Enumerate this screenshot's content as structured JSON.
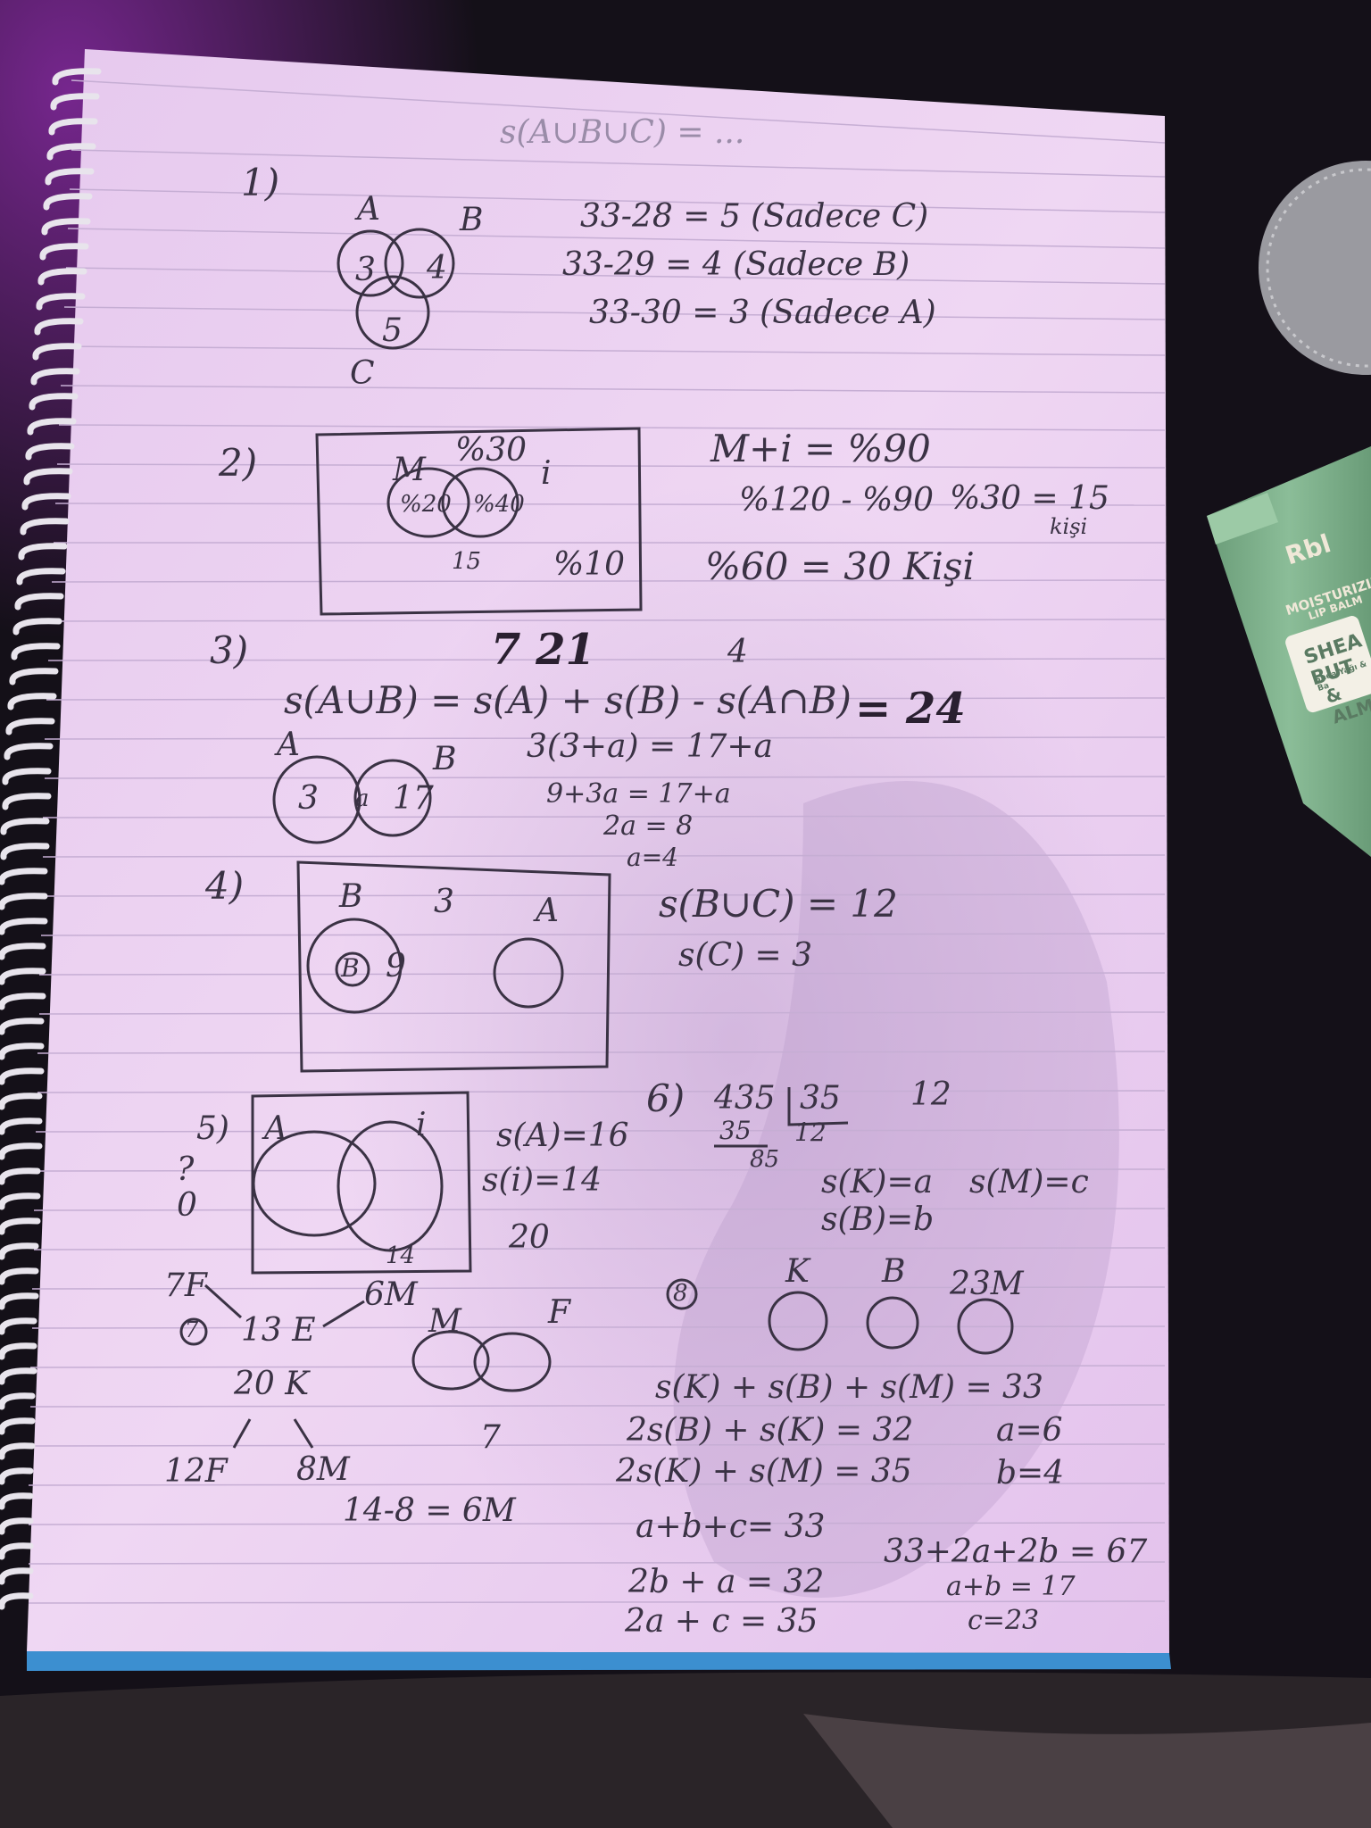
{
  "notebook": {
    "paper_color": "#e9cff0",
    "line_color": "#c9b4d4",
    "ink_color": "#3a3244",
    "binding": "spiral"
  },
  "tube": {
    "brand": "Rbl",
    "line1": "MOISTURIZIN",
    "line2": "LIP BALM",
    "name1": "SHEA BUT",
    "sub": "Shea Yağı & Ba",
    "name2": "& ALM",
    "color": "#7fae8c"
  },
  "problems": {
    "p1": {
      "num": "1)",
      "setA": "A",
      "setB": "B",
      "setC": "C",
      "r3": "3",
      "r4": "4",
      "r5": "5",
      "eq1": "33-28 = 5 (Sadece C)",
      "eq2": "33-29 = 4 (Sadece B)",
      "eq3": "33-30 = 3 (Sadece A)"
    },
    "p2": {
      "num": "2)",
      "m": "M",
      "i": "i",
      "top": "%30",
      "left": "%20",
      "mid": "%40",
      "out": "%10",
      "bottom": "15",
      "eq1": "M+i = %90",
      "eq2": "%120 - %90",
      "eq3": "%30 = 15",
      "eq3b": "kişi",
      "eq4": "%60 = 30 Kişi"
    },
    "p3": {
      "num": "3)",
      "above": "7   21",
      "above2": "4",
      "formula": "s(A∪B) = s(A) + s(B) - s(A∩B)",
      "result": "= 24",
      "a": "A",
      "b": "B",
      "r1": "3",
      "r2": "a",
      "r3": "17",
      "eq1": "3(3+a) = 17+a",
      "eq2": "9+3a = 17+a",
      "eq3": "2a = 8",
      "eq4": "a=4"
    },
    "p4": {
      "num": "4)",
      "b": "B",
      "three": "3",
      "a": "A",
      "inner": "B",
      "nine": "9",
      "eq1": "s(B∪C) = 12",
      "eq2": "s(C) = 3"
    },
    "p5": {
      "num": "5)",
      "a": "A",
      "i": "i",
      "q": "?",
      "zero": "0",
      "below": "14",
      "eq1": "s(A)=16",
      "eq2": "s(i)=14",
      "eq3": "20"
    },
    "p6": {
      "num": "6)",
      "div1": "435",
      "div2": "35",
      "q": "12",
      "sub": "35",
      "rem": "85",
      "side": "12",
      "eq1": "s(K)=a",
      "eq2": "s(B)=b",
      "eq3": "s(M)=c"
    },
    "p7": {
      "num": "7",
      "f7": "7F",
      "e": "13 E",
      "m6": "6M",
      "k": "20 K",
      "f12": "12F",
      "m8": "8M",
      "eq": "14-8 = 6M",
      "m": "M",
      "f": "F",
      "seven": "7"
    },
    "p8": {
      "num": "8",
      "k": "K",
      "b": "B",
      "m": "23M",
      "eq1": "s(K) + s(B) + s(M) = 33",
      "eq2": "2s(B) + s(K) = 32",
      "eq3": "2s(K) + s(M) = 35",
      "r1": "a=6",
      "r2": "b=4",
      "eq4": "a+b+c= 33",
      "eq5": "2b + a = 32",
      "eq6": "2a + c = 35",
      "eq7": "33+2a+2b = 67",
      "eq8": "a+b = 17",
      "eq9": "c=23"
    },
    "faint_top": "s(A∪B∪C) = ..."
  }
}
